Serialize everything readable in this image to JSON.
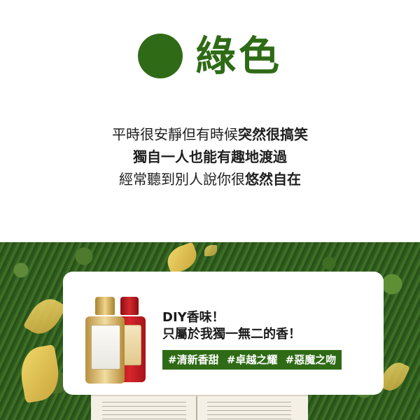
{
  "header": {
    "title": "綠色",
    "dot_color": "#2f6b16"
  },
  "poem": {
    "line1": {
      "normal": "平時很安靜但有時候",
      "bold": "突然很搞笑"
    },
    "line2": {
      "bold": "獨自一人也能有趣地渡過"
    },
    "line3": {
      "normal": "經常聽到別人說你很",
      "bold": "悠然自在"
    }
  },
  "card": {
    "line1": "DIY香味！",
    "line2": "只屬於我獨一無二的香！",
    "tags": [
      "#清新香甜",
      "#卓越之耀",
      "#惡魔之吻"
    ]
  },
  "images": {
    "background": "grass-with-yellow-leaves-and-open-book-photo",
    "product": "gold-and-red-perfume-bottles-icon"
  }
}
